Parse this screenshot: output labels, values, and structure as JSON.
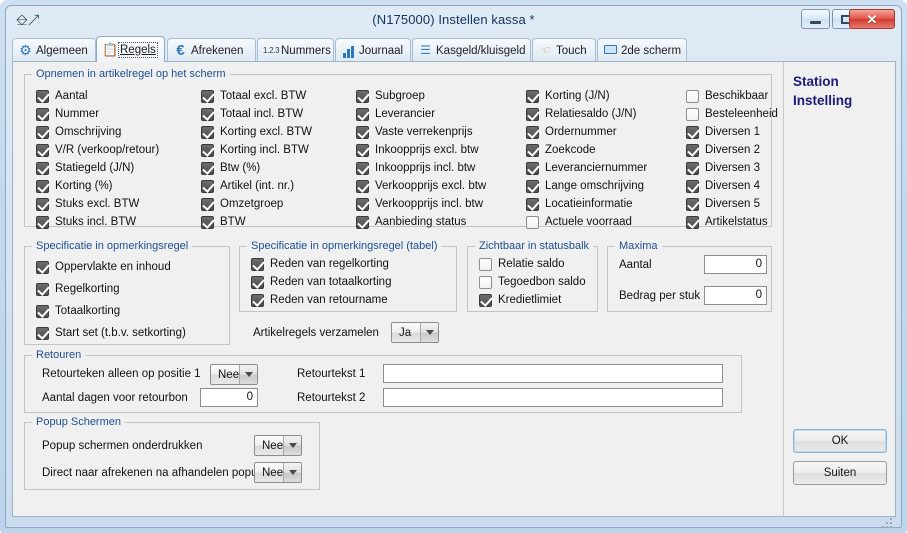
{
  "window": {
    "title": "(N175000) Instellen kassa *",
    "icon": "window-app-icon",
    "minimize_label": "Minimaliseren",
    "maximize_label": "Maximaliseren",
    "close_label": "Sluiten"
  },
  "tabs": [
    {
      "label": "Algemeen",
      "icon": "gear-icon",
      "active": false
    },
    {
      "label": "Regels",
      "icon": "rules-icon",
      "active": true
    },
    {
      "label": "Afrekenen",
      "icon": "euro-icon",
      "active": false
    },
    {
      "label": "Nummers",
      "icon": "numbers-icon",
      "active": false
    },
    {
      "label": "Journaal",
      "icon": "chart-icon",
      "active": false
    },
    {
      "label": "Kasgeld/kluisgeld",
      "icon": "coins-icon",
      "active": false
    },
    {
      "label": "Touch",
      "icon": "hand-icon",
      "active": false
    },
    {
      "label": "2de scherm",
      "icon": "monitor-icon",
      "active": false
    }
  ],
  "groups": {
    "artikelregel": {
      "legend": "Opnemen in artikelregel op het scherm",
      "columns": [
        [
          {
            "label": "Aantal",
            "checked": true
          },
          {
            "label": "Nummer",
            "checked": true
          },
          {
            "label": "Omschrijving",
            "checked": true
          },
          {
            "label": "V/R (verkoop/retour)",
            "checked": true
          },
          {
            "label": "Statiegeld (J/N)",
            "checked": true
          },
          {
            "label": "Korting (%)",
            "checked": true
          },
          {
            "label": "Stuks excl. BTW",
            "checked": true
          },
          {
            "label": "Stuks incl. BTW",
            "checked": true
          }
        ],
        [
          {
            "label": "Totaal excl. BTW",
            "checked": true
          },
          {
            "label": "Totaal incl. BTW",
            "checked": true
          },
          {
            "label": "Korting excl. BTW",
            "checked": true
          },
          {
            "label": "Korting incl. BTW",
            "checked": true
          },
          {
            "label": "Btw (%)",
            "checked": true
          },
          {
            "label": "Artikel (int. nr.)",
            "checked": true
          },
          {
            "label": "Omzetgroep",
            "checked": true
          },
          {
            "label": "BTW",
            "checked": true
          }
        ],
        [
          {
            "label": "Subgroep",
            "checked": true
          },
          {
            "label": "Leverancier",
            "checked": true
          },
          {
            "label": "Vaste verrekenprijs",
            "checked": true
          },
          {
            "label": "Inkoopprijs excl. btw",
            "checked": true
          },
          {
            "label": "Inkoopprijs incl. btw",
            "checked": true
          },
          {
            "label": "Verkoopprijs excl. btw",
            "checked": true
          },
          {
            "label": "Verkoopprijs incl. btw",
            "checked": true
          },
          {
            "label": "Aanbieding status",
            "checked": true
          }
        ],
        [
          {
            "label": "Korting (J/N)",
            "checked": true
          },
          {
            "label": "Relatiesaldo (J/N)",
            "checked": true
          },
          {
            "label": "Ordernummer",
            "checked": true
          },
          {
            "label": "Zoekcode",
            "checked": true
          },
          {
            "label": "Leveranciernummer",
            "checked": true
          },
          {
            "label": "Lange omschrijving",
            "checked": true
          },
          {
            "label": "Locatieinformatie",
            "checked": true
          },
          {
            "label": "Actuele voorraad",
            "checked": false
          }
        ],
        [
          {
            "label": "Beschikbaar",
            "checked": false
          },
          {
            "label": "Besteleenheid",
            "checked": false
          },
          {
            "label": "Diversen 1",
            "checked": true
          },
          {
            "label": "Diversen 2",
            "checked": true
          },
          {
            "label": "Diversen 3",
            "checked": true
          },
          {
            "label": "Diversen 4",
            "checked": true
          },
          {
            "label": "Diversen 5",
            "checked": true
          },
          {
            "label": "Artikelstatus",
            "checked": true
          }
        ]
      ]
    },
    "spec_opmerking": {
      "legend": "Specificatie in opmerkingsregel",
      "items": [
        {
          "label": "Oppervlakte en inhoud",
          "checked": true
        },
        {
          "label": "Regelkorting",
          "checked": true
        },
        {
          "label": "Totaalkorting",
          "checked": true
        },
        {
          "label": "Start set (t.b.v. setkorting)",
          "checked": true
        }
      ]
    },
    "spec_opmerking_tabel": {
      "legend": "Specificatie in opmerkingsregel (tabel)",
      "items": [
        {
          "label": "Reden van regelkorting",
          "checked": true
        },
        {
          "label": "Reden van totaalkorting",
          "checked": true
        },
        {
          "label": "Reden van retourname",
          "checked": true
        }
      ],
      "verzamelen_label": "Artikelregels verzamelen",
      "verzamelen_value": "Ja"
    },
    "statusbalk": {
      "legend": "Zichtbaar in statusbalk",
      "items": [
        {
          "label": "Relatie saldo",
          "checked": false
        },
        {
          "label": "Tegoedbon saldo",
          "checked": false
        },
        {
          "label": "Kredietlimiet",
          "checked": true
        }
      ]
    },
    "maxima": {
      "legend": "Maxima",
      "fields": [
        {
          "label": "Aantal",
          "value": "0"
        },
        {
          "label": "Bedrag per stuk",
          "value": "0"
        }
      ]
    },
    "retouren": {
      "legend": "Retouren",
      "retourteken_label": "Retourteken alleen op positie 1",
      "retourteken_value": "Nee",
      "dagen_label": "Aantal dagen voor retourbon",
      "dagen_value": "0",
      "retourtekst1_label": "Retourtekst 1",
      "retourtekst1_value": "",
      "retourtekst2_label": "Retourtekst 2",
      "retourtekst2_value": ""
    },
    "popup": {
      "legend": "Popup Schermen",
      "onderdrukken_label": "Popup schermen onderdrukken",
      "onderdrukken_value": "Nee",
      "direct_label": "Direct naar afrekenen na afhandelen popups?",
      "direct_value": "Nee"
    }
  },
  "sidepanel": {
    "title_line1": "Station",
    "title_line2": "Instelling",
    "ok_label": "OK",
    "close_label": "Suiten"
  }
}
